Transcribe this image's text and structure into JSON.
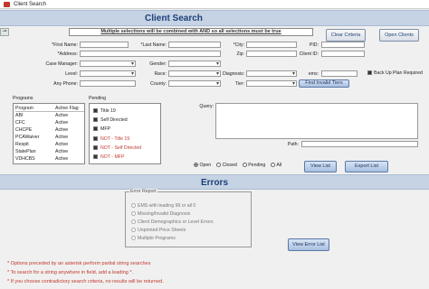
{
  "window": {
    "title": "Client Search"
  },
  "header": {
    "title": "Client Search"
  },
  "pin_icon": "pin-icon",
  "notice": "Multiple selections will be combined with AND so all selections must be true",
  "buttons": {
    "clear_criteria": "Clear Criteria",
    "open_clients": "Open Clients",
    "find_invalid_tiers": "Find Invalid Tiers",
    "view_list": "View List",
    "export_list": "Export List",
    "view_error_list": "View Error List"
  },
  "fields": {
    "first_name": "*First Name:",
    "last_name": "*Last Name:",
    "city": "*City:",
    "pid": "PID:",
    "address": "*Address:",
    "zip": "Zip:",
    "client_id": "Client ID:",
    "case_manager": "Case Manager:",
    "gender": "Gender:",
    "level": "Level:",
    "race": "Race:",
    "diagnosis": "Diagnosis:",
    "ems": "ems:",
    "any_phone": "Any Phone:",
    "county": "County:",
    "tier": "Tier:",
    "back_up_plan": "Back Up Plan Required",
    "query": "Query:",
    "path": "Path:"
  },
  "programs": {
    "title": "Programs",
    "header": [
      "Program",
      "Active Flag"
    ],
    "rows": [
      [
        "ABI",
        "Active"
      ],
      [
        "CFC",
        "Active"
      ],
      [
        "CHCPE",
        "Active"
      ],
      [
        "PCAWaiver",
        "Active"
      ],
      [
        "Respit",
        "Active"
      ],
      [
        "StatePlan",
        "Active"
      ],
      [
        "VDHCBS",
        "Active"
      ]
    ]
  },
  "pending": {
    "title": "Pending",
    "items": [
      {
        "label": "Title 19",
        "color": "#222222"
      },
      {
        "label": "Self Directed",
        "color": "#222222"
      },
      {
        "label": "MFP",
        "color": "#222222"
      },
      {
        "label": "NOT - Title 19",
        "color": "#c0392b"
      },
      {
        "label": "NOT - Self Directed",
        "color": "#c0392b"
      },
      {
        "label": "NOT - MFP",
        "color": "#c0392b"
      }
    ]
  },
  "status_filter": {
    "options": [
      "Open",
      "Closed",
      "Pending",
      "All"
    ],
    "selected": "Open"
  },
  "errors_section": {
    "title": "Errors"
  },
  "error_report": {
    "legend": "Error Report",
    "options": [
      "EMS with leading 99 or all 0",
      "Missing/Invalid Diagnosis",
      "Client Demographics or Level Errors",
      "Unprinted Price Sheets",
      "Multiple Programs"
    ]
  },
  "notes": [
    "* Options preceded by an asterisk perform partial string searches",
    "* To search for a string anywhere in field, add a leading *.",
    "* If you choose contradictory search criteria, no results will be returned."
  ]
}
